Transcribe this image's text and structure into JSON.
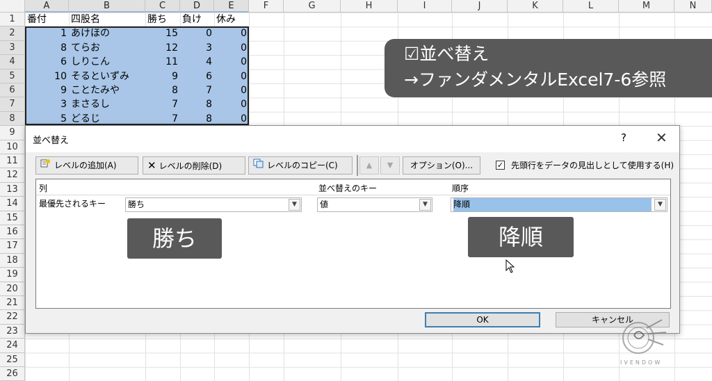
{
  "sheet": {
    "columns": [
      "A",
      "B",
      "C",
      "D",
      "E",
      "F",
      "G",
      "H",
      "I",
      "J",
      "K",
      "L",
      "M",
      "N"
    ],
    "rows": [
      "1",
      "2",
      "3",
      "4",
      "5",
      "6",
      "7",
      "8",
      "9",
      "10",
      "11",
      "12",
      "13",
      "14",
      "15",
      "16",
      "17",
      "18",
      "19",
      "20",
      "21",
      "22",
      "23",
      "24",
      "25",
      "26"
    ],
    "header": {
      "a": "番付",
      "b": "四股名",
      "c": "勝ち",
      "d": "負け",
      "e": "休み"
    },
    "data": [
      {
        "a": "1",
        "b": "あけほの",
        "c": "15",
        "d": "0",
        "e": "0"
      },
      {
        "a": "8",
        "b": "てらお",
        "c": "12",
        "d": "3",
        "e": "0"
      },
      {
        "a": "6",
        "b": "しりこん",
        "c": "11",
        "d": "4",
        "e": "0"
      },
      {
        "a": "10",
        "b": "そるといずみ",
        "c": "9",
        "d": "6",
        "e": "0"
      },
      {
        "a": "9",
        "b": "ことたみや",
        "c": "8",
        "d": "7",
        "e": "0"
      },
      {
        "a": "3",
        "b": "まさるし",
        "c": "7",
        "d": "8",
        "e": "0"
      },
      {
        "a": "5",
        "b": "どるじ",
        "c": "7",
        "d": "8",
        "e": "0"
      }
    ]
  },
  "banner": {
    "line1": "☑並べ替え",
    "line2": "→ファンダメンタルExcel7-6参照"
  },
  "dialog": {
    "title": "並べ替え",
    "help": "?",
    "close": "✕",
    "toolbar": {
      "add_level": "レベルの追加(A)",
      "delete_level": "レベルの削除(D)",
      "copy_level": "レベルのコピー(C)",
      "up": "▲",
      "down": "▼",
      "options": "オプション(O)...",
      "header_checkbox_label": "先頭行をデータの見出しとして使用する(H)",
      "header_checked": "✓"
    },
    "columns": {
      "col": "列",
      "key": "並べ替えのキー",
      "order": "順序"
    },
    "row": {
      "label": "最優先されるキー",
      "column_value": "勝ち",
      "key_value": "値",
      "order_value": "降順"
    },
    "ok": "OK",
    "cancel": "キャンセル"
  },
  "overlays": {
    "wins_badge": "勝ち",
    "descending_badge": "降順"
  },
  "watermark": {
    "text": "IVENDOW"
  }
}
